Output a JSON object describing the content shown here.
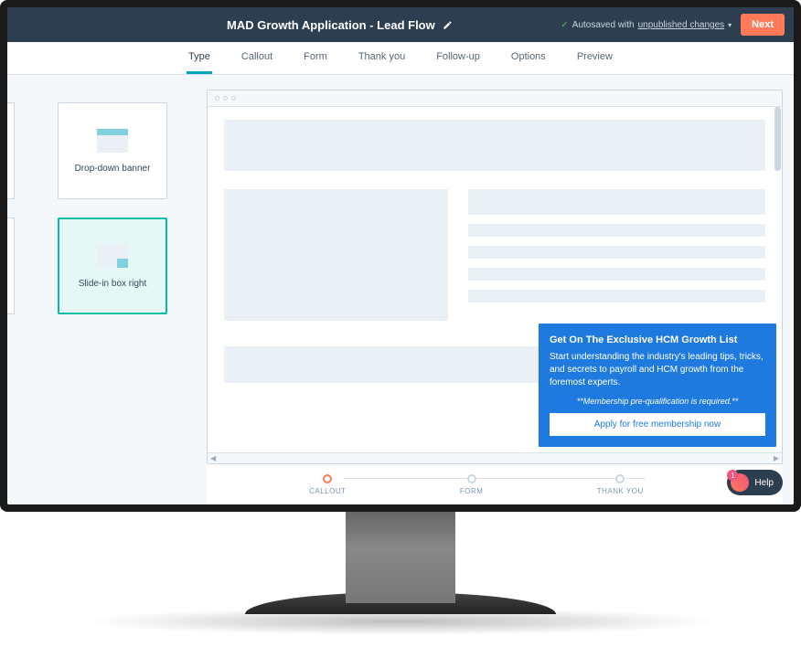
{
  "header": {
    "title": "MAD Growth Application - Lead Flow",
    "autosave_prefix": "Autosaved with",
    "autosave_link": "unpublished changes",
    "next_label": "Next"
  },
  "tabs": [
    {
      "label": "Type"
    },
    {
      "label": "Callout"
    },
    {
      "label": "Form"
    },
    {
      "label": "Thank you"
    },
    {
      "label": "Follow-up"
    },
    {
      "label": "Options"
    },
    {
      "label": "Preview"
    }
  ],
  "types": {
    "dropdown_label": "Drop-down banner",
    "slidein_label": "Slide-in box right"
  },
  "callout": {
    "title": "Get On The Exclusive HCM Growth List",
    "body": "Start understanding the industry's leading tips, tricks, and secrets to payroll and HCM growth from the foremost experts.",
    "note": "**Membership pre-qualification is required.**",
    "button": "Apply for free membership now"
  },
  "stepper": [
    {
      "label": "CALLOUT"
    },
    {
      "label": "FORM"
    },
    {
      "label": "THANK YOU"
    }
  ],
  "help": {
    "label": "Help",
    "badge": "1"
  },
  "colors": {
    "accent": "#ff7a59",
    "teal": "#00bda5",
    "callout_bg": "#1f7ae0"
  }
}
